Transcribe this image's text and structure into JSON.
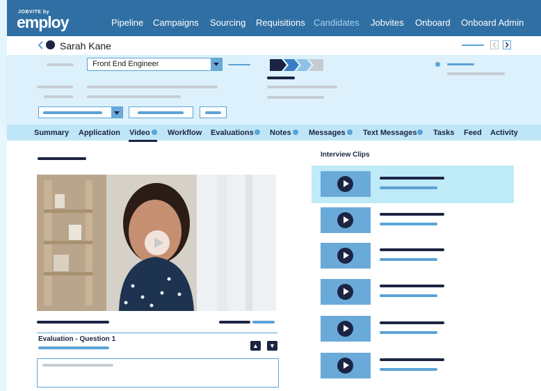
{
  "brand": {
    "small": "JOBVITE by",
    "main": "employ"
  },
  "nav": {
    "items": [
      {
        "label": "Pipeline"
      },
      {
        "label": "Campaigns"
      },
      {
        "label": "Sourcing"
      },
      {
        "label": "Requisitions"
      },
      {
        "label": "Candidates"
      },
      {
        "label": "Jobvites"
      },
      {
        "label": "Onboard"
      },
      {
        "label": "Onboard Admin"
      }
    ],
    "active": "Candidates"
  },
  "candidate": {
    "name": "Sarah Kane",
    "job_select": "Front End Engineer"
  },
  "tabs": [
    {
      "label": "Summary"
    },
    {
      "label": "Application"
    },
    {
      "label": "Video"
    },
    {
      "label": "Workflow"
    },
    {
      "label": "Evaluations"
    },
    {
      "label": "Notes"
    },
    {
      "label": "Messages"
    },
    {
      "label": "Text Messages"
    },
    {
      "label": "Tasks"
    },
    {
      "label": "Feed"
    },
    {
      "label": "Activity"
    }
  ],
  "active_tab": "Video",
  "evaluation": {
    "label": "Evaluation - Question 1"
  },
  "clips": {
    "title": "Interview Clips",
    "count_shown": 6,
    "selected_index": 0
  },
  "colors": {
    "nav_bg": "#2f6fa3",
    "accent": "#5aa3d8",
    "navy": "#1b2444",
    "panel": "#dcf1fb",
    "tabs_bg": "#bfe6f6"
  }
}
